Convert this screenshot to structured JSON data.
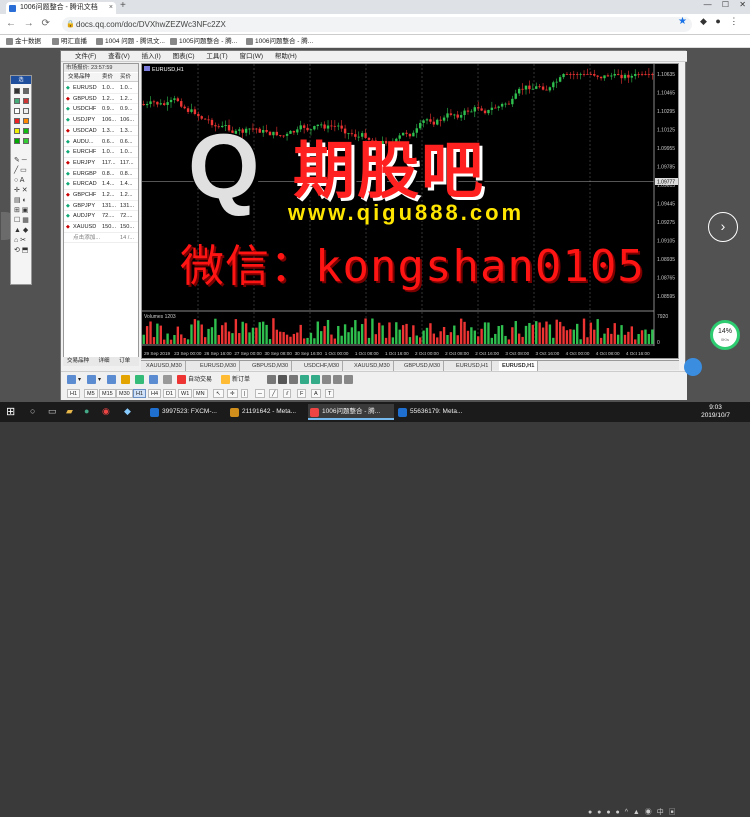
{
  "browser": {
    "tab_title": "1006问题整合 - 腾讯文档",
    "url": "docs.qq.com/doc/DVXhwZEZWc3NFc2ZX",
    "bookmarks": [
      "金十数据",
      "明汇直播",
      "1004 问题 - 腾讯文...",
      "1005问题整合 - 腾...",
      "1006问题整合 - 腾..."
    ]
  },
  "mt4": {
    "menu": [
      "文件(F)",
      "查看(V)",
      "插入(I)",
      "图表(C)",
      "工具(T)",
      "窗口(W)",
      "帮助(H)"
    ],
    "market_watch": {
      "title": "市场报价: 23:57:59",
      "columns": [
        "交易品种",
        "卖价",
        "买价"
      ],
      "rows": [
        {
          "symbol": "EURUSD",
          "bid": "1.0...",
          "ask": "1.0..."
        },
        {
          "symbol": "GBPUSD",
          "bid": "1.2...",
          "ask": "1.2..."
        },
        {
          "symbol": "USDCHF",
          "bid": "0.9...",
          "ask": "0.9..."
        },
        {
          "symbol": "USDJPY",
          "bid": "106...",
          "ask": "106..."
        },
        {
          "symbol": "USDCAD",
          "bid": "1.3...",
          "ask": "1.3..."
        },
        {
          "symbol": "AUDU...",
          "bid": "0.6...",
          "ask": "0.6..."
        },
        {
          "symbol": "EURCHF",
          "bid": "1.0...",
          "ask": "1.0..."
        },
        {
          "symbol": "EURJPY",
          "bid": "117...",
          "ask": "117..."
        },
        {
          "symbol": "EURGBP",
          "bid": "0.8...",
          "ask": "0.8..."
        },
        {
          "symbol": "EURCAD",
          "bid": "1.4...",
          "ask": "1.4..."
        },
        {
          "symbol": "GBPCHF",
          "bid": "1.2...",
          "ask": "1.2..."
        },
        {
          "symbol": "GBPJPY",
          "bid": "131...",
          "ask": "131..."
        },
        {
          "symbol": "AUDJPY",
          "bid": "72....",
          "ask": "72...."
        },
        {
          "symbol": "XAUUSD",
          "bid": "150...",
          "ask": "150..."
        }
      ],
      "footer": "点击添加...",
      "footer_count": "14 /...",
      "tabs": [
        "交易品种",
        "详细",
        "订单"
      ]
    },
    "chart": {
      "title": "EURUSD,H1",
      "volumes_label": "Volumes 1203",
      "price_labels": [
        "1.10635",
        "1.10465",
        "1.10295",
        "1.10125",
        "1.09955",
        "1.09785",
        "1.09615",
        "1.09445",
        "1.09275",
        "1.09105",
        "1.08935",
        "1.08765",
        "1.08595"
      ],
      "current_price": "1.09777",
      "vol_labels": [
        "7920",
        "0"
      ],
      "time_labels": [
        "29 Sep 2019",
        "23 Sep 00:00",
        "26 Sep 16:00",
        "27 Sep 00:00",
        "30 Sep 08:00",
        "30 Sep 16:00",
        "1 Oct 00:00",
        "1 Oct 08:00",
        "1 Oct 16:00",
        "2 Oct 00:00",
        "2 Oct 08:00",
        "2 Oct 16:00",
        "3 Oct 08:00",
        "3 Oct 16:00",
        "4 Oct 00:00",
        "4 Oct 08:00",
        "4 Oct 16:00"
      ]
    },
    "chart_tabs": [
      "XAUUSD,M30",
      "EURUSD,M30",
      "GBPUSD,M30",
      "USDCHF,M30",
      "XAUUSD,M30",
      "GBPUSD,M30",
      "EURUSD,H1",
      "EURUSD,H1"
    ],
    "toolbar": {
      "auto_trade": "自动交易",
      "new_order": "新订单"
    },
    "timeframes": [
      "H1",
      "M5",
      "M15",
      "M30",
      "H1",
      "H4",
      "D1",
      "W1",
      "MN"
    ],
    "timeframe_active_index": 4
  },
  "watermark": {
    "logo": "Q",
    "logo_cn": "期股吧",
    "site": "www.qigu888.com",
    "wechat": "微信：kongshan0105"
  },
  "overlay": {
    "progress_percent": "14%",
    "progress_sub": "0K/s"
  },
  "taskbar": {
    "items": [
      "3997523: FXCM-...",
      "21191642 - Meta...",
      "1006问题整合 - 腾...",
      "55636179: Meta..."
    ],
    "active_index": 2,
    "time": "9:03",
    "date": "2019/10/7"
  }
}
